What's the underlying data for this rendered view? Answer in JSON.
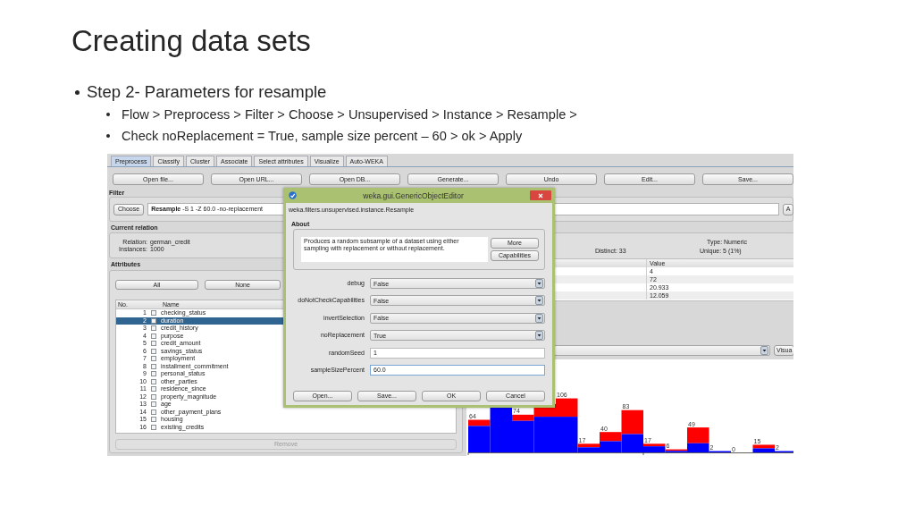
{
  "slide": {
    "title": "Creating data sets",
    "bullets": [
      {
        "text": "Step 2- Parameters for resample",
        "children": [
          {
            "text": "Flow > Preprocess > Filter > Choose > Unsupervised > Instance > Resample >"
          },
          {
            "text": "Check noReplacement = True, sample size percent – 60 > ok > Apply"
          }
        ]
      }
    ]
  },
  "explorer": {
    "tabs": [
      {
        "label": "Preprocess",
        "selected": true
      },
      {
        "label": "Classify",
        "selected": false
      },
      {
        "label": "Cluster",
        "selected": false
      },
      {
        "label": "Associate",
        "selected": false
      },
      {
        "label": "Select attributes",
        "selected": false
      },
      {
        "label": "Visualize",
        "selected": false
      },
      {
        "label": "Auto-WEKA",
        "selected": false
      }
    ],
    "toolbar": [
      "Open file...",
      "Open URL...",
      "Open DB...",
      "Generate...",
      "Undo",
      "Edit...",
      "Save..."
    ],
    "filter": {
      "label": "Filter",
      "choose": "Choose",
      "value": "**Resample** -S 1 -Z 60.0 -no-replacement",
      "apply": "A"
    },
    "current_relation": {
      "label": "Current relation",
      "relation_label": "Relation:",
      "relation": "german_credit",
      "instances_label": "Instances:",
      "instances": "1000"
    },
    "attributes": {
      "label": "Attributes",
      "buttons": [
        "All",
        "None"
      ],
      "columns": [
        "No.",
        "Name"
      ],
      "rows": [
        {
          "no": "1",
          "name": "checking_status",
          "selected": false,
          "checked": false
        },
        {
          "no": "2",
          "name": "duration",
          "selected": true,
          "checked": false
        },
        {
          "no": "3",
          "name": "credit_history",
          "selected": false,
          "checked": false
        },
        {
          "no": "4",
          "name": "purpose",
          "selected": false,
          "checked": false
        },
        {
          "no": "5",
          "name": "credit_amount",
          "selected": false,
          "checked": false
        },
        {
          "no": "6",
          "name": "savings_status",
          "selected": false,
          "checked": false
        },
        {
          "no": "7",
          "name": "employment",
          "selected": false,
          "checked": false
        },
        {
          "no": "8",
          "name": "installment_commitment",
          "selected": false,
          "checked": false
        },
        {
          "no": "9",
          "name": "personal_status",
          "selected": false,
          "checked": false
        },
        {
          "no": "10",
          "name": "other_parties",
          "selected": false,
          "checked": false
        },
        {
          "no": "11",
          "name": "residence_since",
          "selected": false,
          "checked": false
        },
        {
          "no": "12",
          "name": "property_magnitude",
          "selected": false,
          "checked": false
        },
        {
          "no": "13",
          "name": "age",
          "selected": false,
          "checked": false
        },
        {
          "no": "14",
          "name": "other_payment_plans",
          "selected": false,
          "checked": false
        },
        {
          "no": "15",
          "name": "housing",
          "selected": false,
          "checked": false
        },
        {
          "no": "16",
          "name": "existing_credits",
          "selected": false,
          "checked": false
        }
      ],
      "remove": {
        "label": "Remove",
        "disabled": true
      }
    },
    "selected_attribute": {
      "type": "Type: Numeric",
      "distinct": "Distinct: 33",
      "unique": "Unique: 5 (1%)",
      "columns": [
        "Value"
      ],
      "values": [
        "4",
        "72",
        "20.933",
        "12.059"
      ],
      "visualize": "Visua"
    },
    "histogram": {
      "bar_labels": [
        "64",
        "74",
        "106",
        "17",
        "40",
        "83",
        "17",
        "6",
        "49",
        "2",
        "0",
        "15",
        "2"
      ]
    }
  },
  "dialog": {
    "title": "weka.gui.GenericObjectEditor",
    "class_name": "weka.filters.unsupervised.instance.Resample",
    "about_label": "About",
    "about": "Produces a random subsample of a dataset using either sampling with replacement or without replacement.",
    "about_buttons": [
      "More",
      "Capabilities"
    ],
    "properties": [
      {
        "name": "debug",
        "kind": "dropdown",
        "value": "False"
      },
      {
        "name": "doNotCheckCapabilities",
        "kind": "dropdown",
        "value": "False"
      },
      {
        "name": "invertSelection",
        "kind": "dropdown",
        "value": "False"
      },
      {
        "name": "noReplacement",
        "kind": "dropdown",
        "value": "True"
      },
      {
        "name": "randomSeed",
        "kind": "text",
        "value": "1",
        "focused": false
      },
      {
        "name": "sampleSizePercent",
        "kind": "text",
        "value": "60.0",
        "focused": true
      }
    ],
    "buttons": [
      "Open...",
      "Save...",
      "OK",
      "Cancel"
    ]
  }
}
